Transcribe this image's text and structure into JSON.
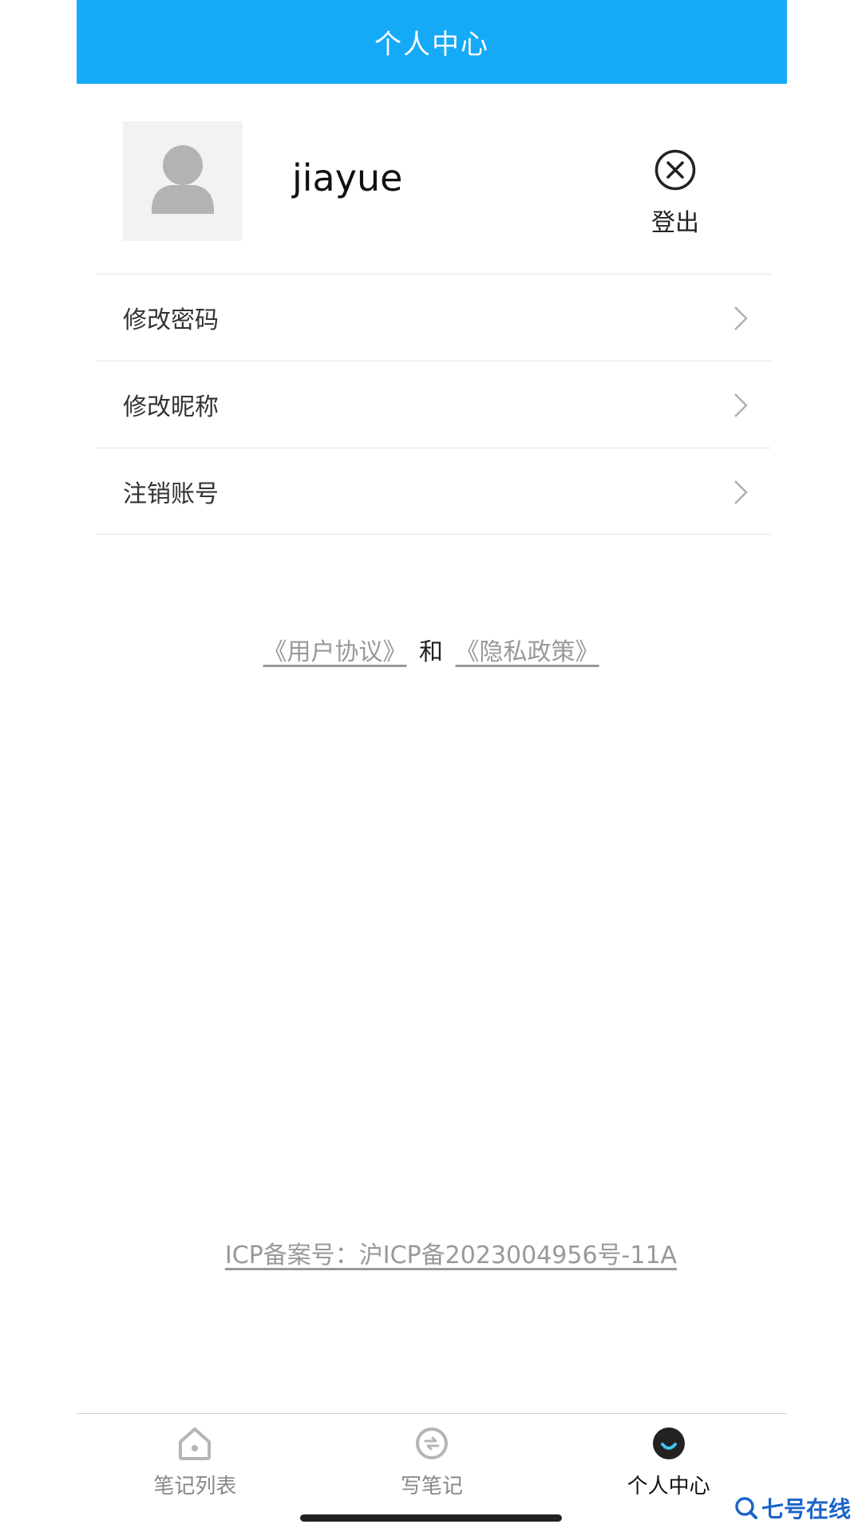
{
  "header": {
    "title": "个人中心"
  },
  "profile": {
    "username": "jiayue",
    "logout_label": "登出",
    "avatar_icon": "user-placeholder-icon"
  },
  "menu": {
    "items": [
      {
        "label": "修改密码",
        "icon": "chevron-right-icon"
      },
      {
        "label": "修改昵称",
        "icon": "chevron-right-icon"
      },
      {
        "label": "注销账号",
        "icon": "chevron-right-icon"
      }
    ]
  },
  "agreements": {
    "user_agreement": "《用户协议》",
    "and": "和",
    "privacy_policy": "《隐私政策》"
  },
  "icp": {
    "text": "ICP备案号：沪ICP备2023004956号-11A"
  },
  "tabbar": {
    "tabs": [
      {
        "label": "笔记列表",
        "icon": "home-icon",
        "active": false
      },
      {
        "label": "写笔记",
        "icon": "write-note-icon",
        "active": false
      },
      {
        "label": "个人中心",
        "icon": "profile-face-icon",
        "active": true
      }
    ]
  },
  "watermark": {
    "text": "七号在线"
  },
  "colors": {
    "header_bg": "#15aaf7",
    "link_gray": "#999999",
    "divider": "#e3e3e3",
    "watermark_blue": "#1a64c8"
  }
}
